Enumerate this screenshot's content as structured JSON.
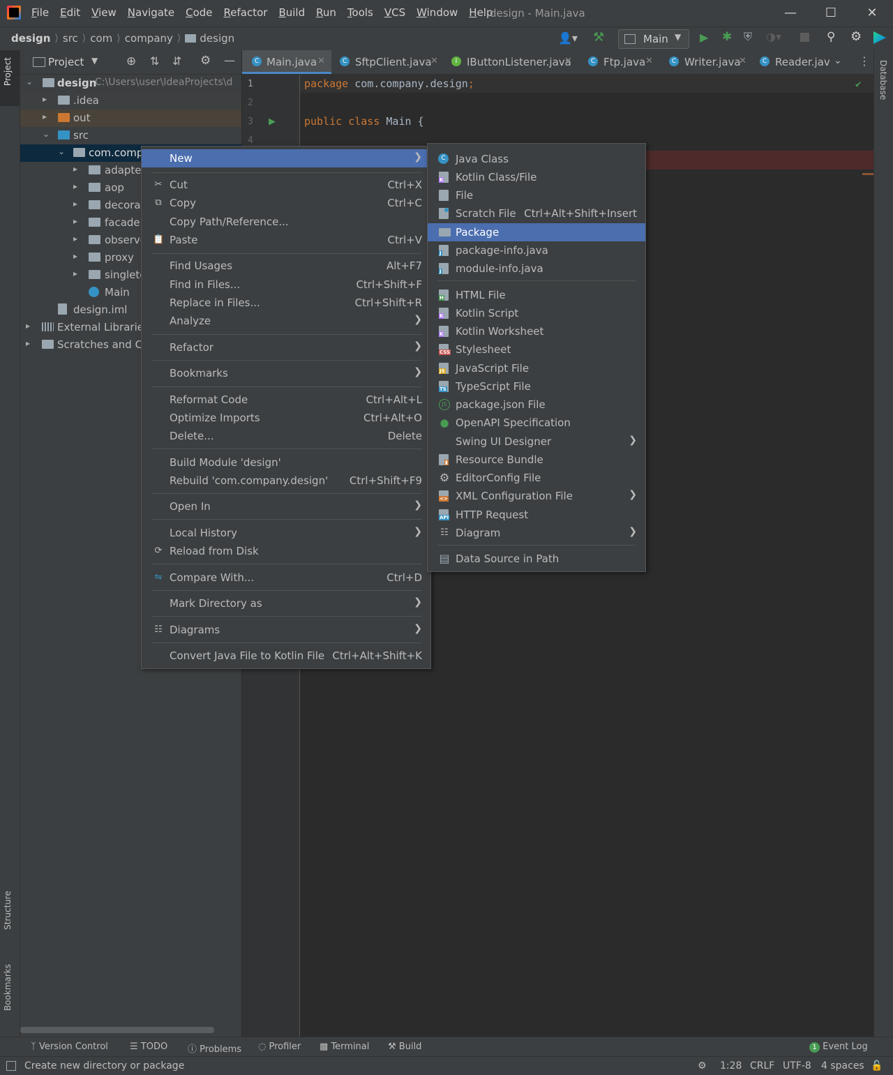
{
  "window": {
    "title": "design - Main.java",
    "menu": [
      "File",
      "Edit",
      "View",
      "Navigate",
      "Code",
      "Refactor",
      "Build",
      "Run",
      "Tools",
      "VCS",
      "Window",
      "Help"
    ]
  },
  "breadcrumb": [
    "design",
    "src",
    "com",
    "company",
    "design"
  ],
  "run_config": "Main",
  "left_strip": {
    "project": "Project",
    "structure": "Structure",
    "bookmarks": "Bookmarks"
  },
  "right_strip": {
    "database": "Database"
  },
  "project_panel": {
    "title": "Project",
    "root_name": "design",
    "root_path": "C:\\Users\\user\\IdeaProjects\\d",
    "tree": [
      {
        "label": ".idea"
      },
      {
        "label": "out"
      },
      {
        "label": "src"
      },
      {
        "label": "com.compa"
      },
      {
        "label": "adapter"
      },
      {
        "label": "aop"
      },
      {
        "label": "decorat"
      },
      {
        "label": "facade"
      },
      {
        "label": "observe"
      },
      {
        "label": "proxy"
      },
      {
        "label": "singleto"
      },
      {
        "label": "Main"
      },
      {
        "label": "design.iml"
      },
      {
        "label": "External Libraries"
      },
      {
        "label": "Scratches and Co"
      }
    ]
  },
  "tabs": [
    "Main.java",
    "SftpClient.java",
    "IButtonListener.java",
    "Ftp.java",
    "Writer.java",
    "Reader.jav"
  ],
  "editor": {
    "line_numbers": [
      "1",
      "2",
      "3",
      "4"
    ],
    "line1_kw": "package",
    "line1_rest": " com.company.design",
    "line1_semi": ";",
    "line3_kw1": "public",
    "line3_kw2": "class",
    "line3_rest": " Main {"
  },
  "context_menu": [
    {
      "label": "New",
      "submenu": true
    },
    {
      "label": "Cut",
      "shortcut": "Ctrl+X"
    },
    {
      "label": "Copy",
      "shortcut": "Ctrl+C"
    },
    {
      "label": "Copy Path/Reference..."
    },
    {
      "label": "Paste",
      "shortcut": "Ctrl+V"
    },
    {
      "label": "Find Usages",
      "shortcut": "Alt+F7"
    },
    {
      "label": "Find in Files...",
      "shortcut": "Ctrl+Shift+F"
    },
    {
      "label": "Replace in Files...",
      "shortcut": "Ctrl+Shift+R"
    },
    {
      "label": "Analyze",
      "submenu": true
    },
    {
      "label": "Refactor",
      "submenu": true
    },
    {
      "label": "Bookmarks",
      "submenu": true
    },
    {
      "label": "Reformat Code",
      "shortcut": "Ctrl+Alt+L"
    },
    {
      "label": "Optimize Imports",
      "shortcut": "Ctrl+Alt+O"
    },
    {
      "label": "Delete...",
      "shortcut": "Delete"
    },
    {
      "label": "Build Module 'design'"
    },
    {
      "label": "Rebuild 'com.company.design'",
      "shortcut": "Ctrl+Shift+F9"
    },
    {
      "label": "Open In",
      "submenu": true
    },
    {
      "label": "Local History",
      "submenu": true
    },
    {
      "label": "Reload from Disk"
    },
    {
      "label": "Compare With...",
      "shortcut": "Ctrl+D"
    },
    {
      "label": "Mark Directory as",
      "submenu": true
    },
    {
      "label": "Diagrams",
      "submenu": true
    },
    {
      "label": "Convert Java File to Kotlin File",
      "shortcut": "Ctrl+Alt+Shift+K"
    }
  ],
  "new_submenu": [
    {
      "label": "Java Class"
    },
    {
      "label": "Kotlin Class/File"
    },
    {
      "label": "File"
    },
    {
      "label": "Scratch File",
      "shortcut": "Ctrl+Alt+Shift+Insert"
    },
    {
      "label": "Package"
    },
    {
      "label": "package-info.java"
    },
    {
      "label": "module-info.java"
    },
    {
      "label": "HTML File"
    },
    {
      "label": "Kotlin Script"
    },
    {
      "label": "Kotlin Worksheet"
    },
    {
      "label": "Stylesheet"
    },
    {
      "label": "JavaScript File"
    },
    {
      "label": "TypeScript File"
    },
    {
      "label": "package.json File"
    },
    {
      "label": "OpenAPI Specification"
    },
    {
      "label": "Swing UI Designer",
      "submenu": true
    },
    {
      "label": "Resource Bundle"
    },
    {
      "label": "EditorConfig File"
    },
    {
      "label": "XML Configuration File",
      "submenu": true
    },
    {
      "label": "HTTP Request"
    },
    {
      "label": "Diagram",
      "submenu": true
    },
    {
      "label": "Data Source in Path"
    }
  ],
  "tool_windows": [
    "Version Control",
    "TODO",
    "Problems",
    "Profiler",
    "Terminal",
    "Build"
  ],
  "event_log": {
    "count": "1",
    "label": "Event Log"
  },
  "status": {
    "message": "Create new directory or package",
    "position": "1:28",
    "line_sep": "CRLF",
    "encoding": "UTF-8",
    "indent": "4 spaces"
  },
  "colors": {
    "selection": "#4b6eaf",
    "accent_orange": "#cc7832",
    "folder_blue": "#3592c4",
    "run_green": "#499c54"
  }
}
